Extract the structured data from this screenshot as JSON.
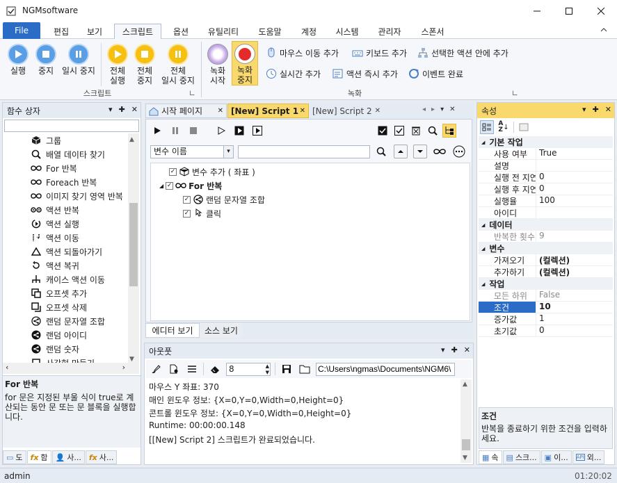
{
  "window": {
    "title": "NGMsoftware"
  },
  "menu": {
    "file": "File",
    "tabs": [
      "편집",
      "보기",
      "스크립트",
      "옵션",
      "유틸리티",
      "도움말",
      "계정",
      "시스템",
      "관리자",
      "스폰서"
    ]
  },
  "ribbon": {
    "script_group": {
      "label": "스크립트",
      "buttons": [
        "실행",
        "중지",
        "일시 중지"
      ],
      "all_buttons": [
        [
          "전체",
          "실행"
        ],
        [
          "전체",
          "중지"
        ],
        [
          "전체",
          "일시 중지"
        ]
      ]
    },
    "record_group": {
      "label": "녹화",
      "start": [
        "녹화",
        "시작"
      ],
      "stop": [
        "녹화",
        "중지"
      ],
      "actions": [
        "마우스 이동 추가",
        "키보드 추가",
        "선택한 액션 안에 추가",
        "실시간 추가",
        "액션 즉시 추가",
        "이벤트 완료"
      ]
    }
  },
  "func_panel": {
    "title": "함수 상자",
    "search_value": "",
    "items": [
      {
        "label": "그룹",
        "icon": "cube-icon"
      },
      {
        "label": "배열 데이타 찾기",
        "icon": "search-icon"
      },
      {
        "label": "For 반복",
        "icon": "infinity-icon"
      },
      {
        "label": "Foreach 반복",
        "icon": "infinity-icon"
      },
      {
        "label": "이미지 찾기 영역 반복",
        "icon": "infinity-icon"
      },
      {
        "label": "액션 반복",
        "icon": "loop-icon"
      },
      {
        "label": "액션 실행",
        "icon": "run-icon"
      },
      {
        "label": "액션 이동",
        "icon": "move-icon"
      },
      {
        "label": "액션 되돌아가기",
        "icon": "undo-icon"
      },
      {
        "label": "액션 복귀",
        "icon": "return-icon"
      },
      {
        "label": "캐이스 액션 이동",
        "icon": "tree-icon"
      },
      {
        "label": "오프셋 추가",
        "icon": "offset-add-icon"
      },
      {
        "label": "오프셋 삭제",
        "icon": "offset-delete-icon"
      },
      {
        "label": "랜덤 문자열 조합",
        "icon": "share-icon"
      },
      {
        "label": "랜덤 아이디",
        "icon": "share-filled-icon"
      },
      {
        "label": "랜덤 숫자",
        "icon": "share-filled-icon"
      },
      {
        "label": "사각형 만들기",
        "icon": "square-icon"
      }
    ],
    "desc_title": "For 반복",
    "desc_text": "for 문은 지정된 부울 식이 true로 계산되는 동안 문 또는 문 블록을 실행합니다.",
    "bottom_tabs": [
      "도",
      "함",
      "사...",
      "사..."
    ]
  },
  "editor": {
    "tabs": [
      "시작 페이지",
      "[New] Script 1",
      "[New] Script 2"
    ],
    "var_select": "변수 이름",
    "search_value": "",
    "tree": [
      {
        "label": "변수 추가 ( 좌표 )",
        "level": 1,
        "icon": "var-icon"
      },
      {
        "label": "For 반복",
        "level": 0,
        "icon": "infinity-icon",
        "expanded": true
      },
      {
        "label": "랜덤 문자열 조합",
        "level": 2,
        "icon": "share-icon"
      },
      {
        "label": "클릭",
        "level": 2,
        "icon": "click-icon"
      }
    ],
    "bottom_tabs": [
      "에디터 보기",
      "소스 보기"
    ]
  },
  "output": {
    "title": "아웃풋",
    "font_size_value": "8",
    "path_value": "C:\\Users\\ngmas\\Documents\\NGM6\\",
    "lines": [
      "마우스 Y 좌표: 370",
      "매인 윈도우 정보: {X=0,Y=0,Width=0,Height=0}",
      "콘트롤 윈도우 정보: {X=0,Y=0,Width=0,Height=0}",
      "Runtime: 00:00:00.148",
      "[[New] Script 2] 스크립트가 완료되었습니다."
    ]
  },
  "props": {
    "title": "속성",
    "categories": [
      {
        "name": "기본 작업",
        "rows": [
          {
            "name": "사용 여부",
            "value": "True",
            "grey": false,
            "bold": false
          },
          {
            "name": "설명",
            "value": "",
            "grey": false,
            "bold": false
          },
          {
            "name": "실행 전 지연",
            "value": "0",
            "grey": false,
            "bold": false
          },
          {
            "name": "실행 후 지연",
            "value": "0",
            "grey": false,
            "bold": false
          },
          {
            "name": "실행율",
            "value": "100",
            "grey": false,
            "bold": false
          },
          {
            "name": "아이디",
            "value": "",
            "grey": false,
            "bold": false
          }
        ]
      },
      {
        "name": "데이터",
        "rows": [
          {
            "name": "반복한 횟수",
            "value": "9",
            "grey": true,
            "bold": false
          }
        ]
      },
      {
        "name": "변수",
        "rows": [
          {
            "name": "가져오기",
            "value": "(컬렉션)",
            "grey": false,
            "bold": true
          },
          {
            "name": "추가하기",
            "value": "(컬렉션)",
            "grey": false,
            "bold": true
          }
        ]
      },
      {
        "name": "작업",
        "rows": [
          {
            "name": "모든 하위",
            "value": "False",
            "grey": true,
            "bold": false
          },
          {
            "name": "조건",
            "value": "10",
            "grey": false,
            "bold": true,
            "selected": true
          },
          {
            "name": "증가값",
            "value": "1",
            "grey": false,
            "bold": false
          },
          {
            "name": "초기값",
            "value": "0",
            "grey": false,
            "bold": false
          }
        ]
      }
    ],
    "desc_title": "조건",
    "desc_text": "반복을 종료하기 위한 조건을 입력하세요.",
    "bottom_tabs": [
      "속",
      "스크...",
      "이...",
      "외..."
    ]
  },
  "status": {
    "user": "admin",
    "time": "01:20:02"
  },
  "colors": {
    "accent": "#2b6cc7",
    "active_header": "#f9d96b",
    "record_stop": "#f5c542"
  }
}
